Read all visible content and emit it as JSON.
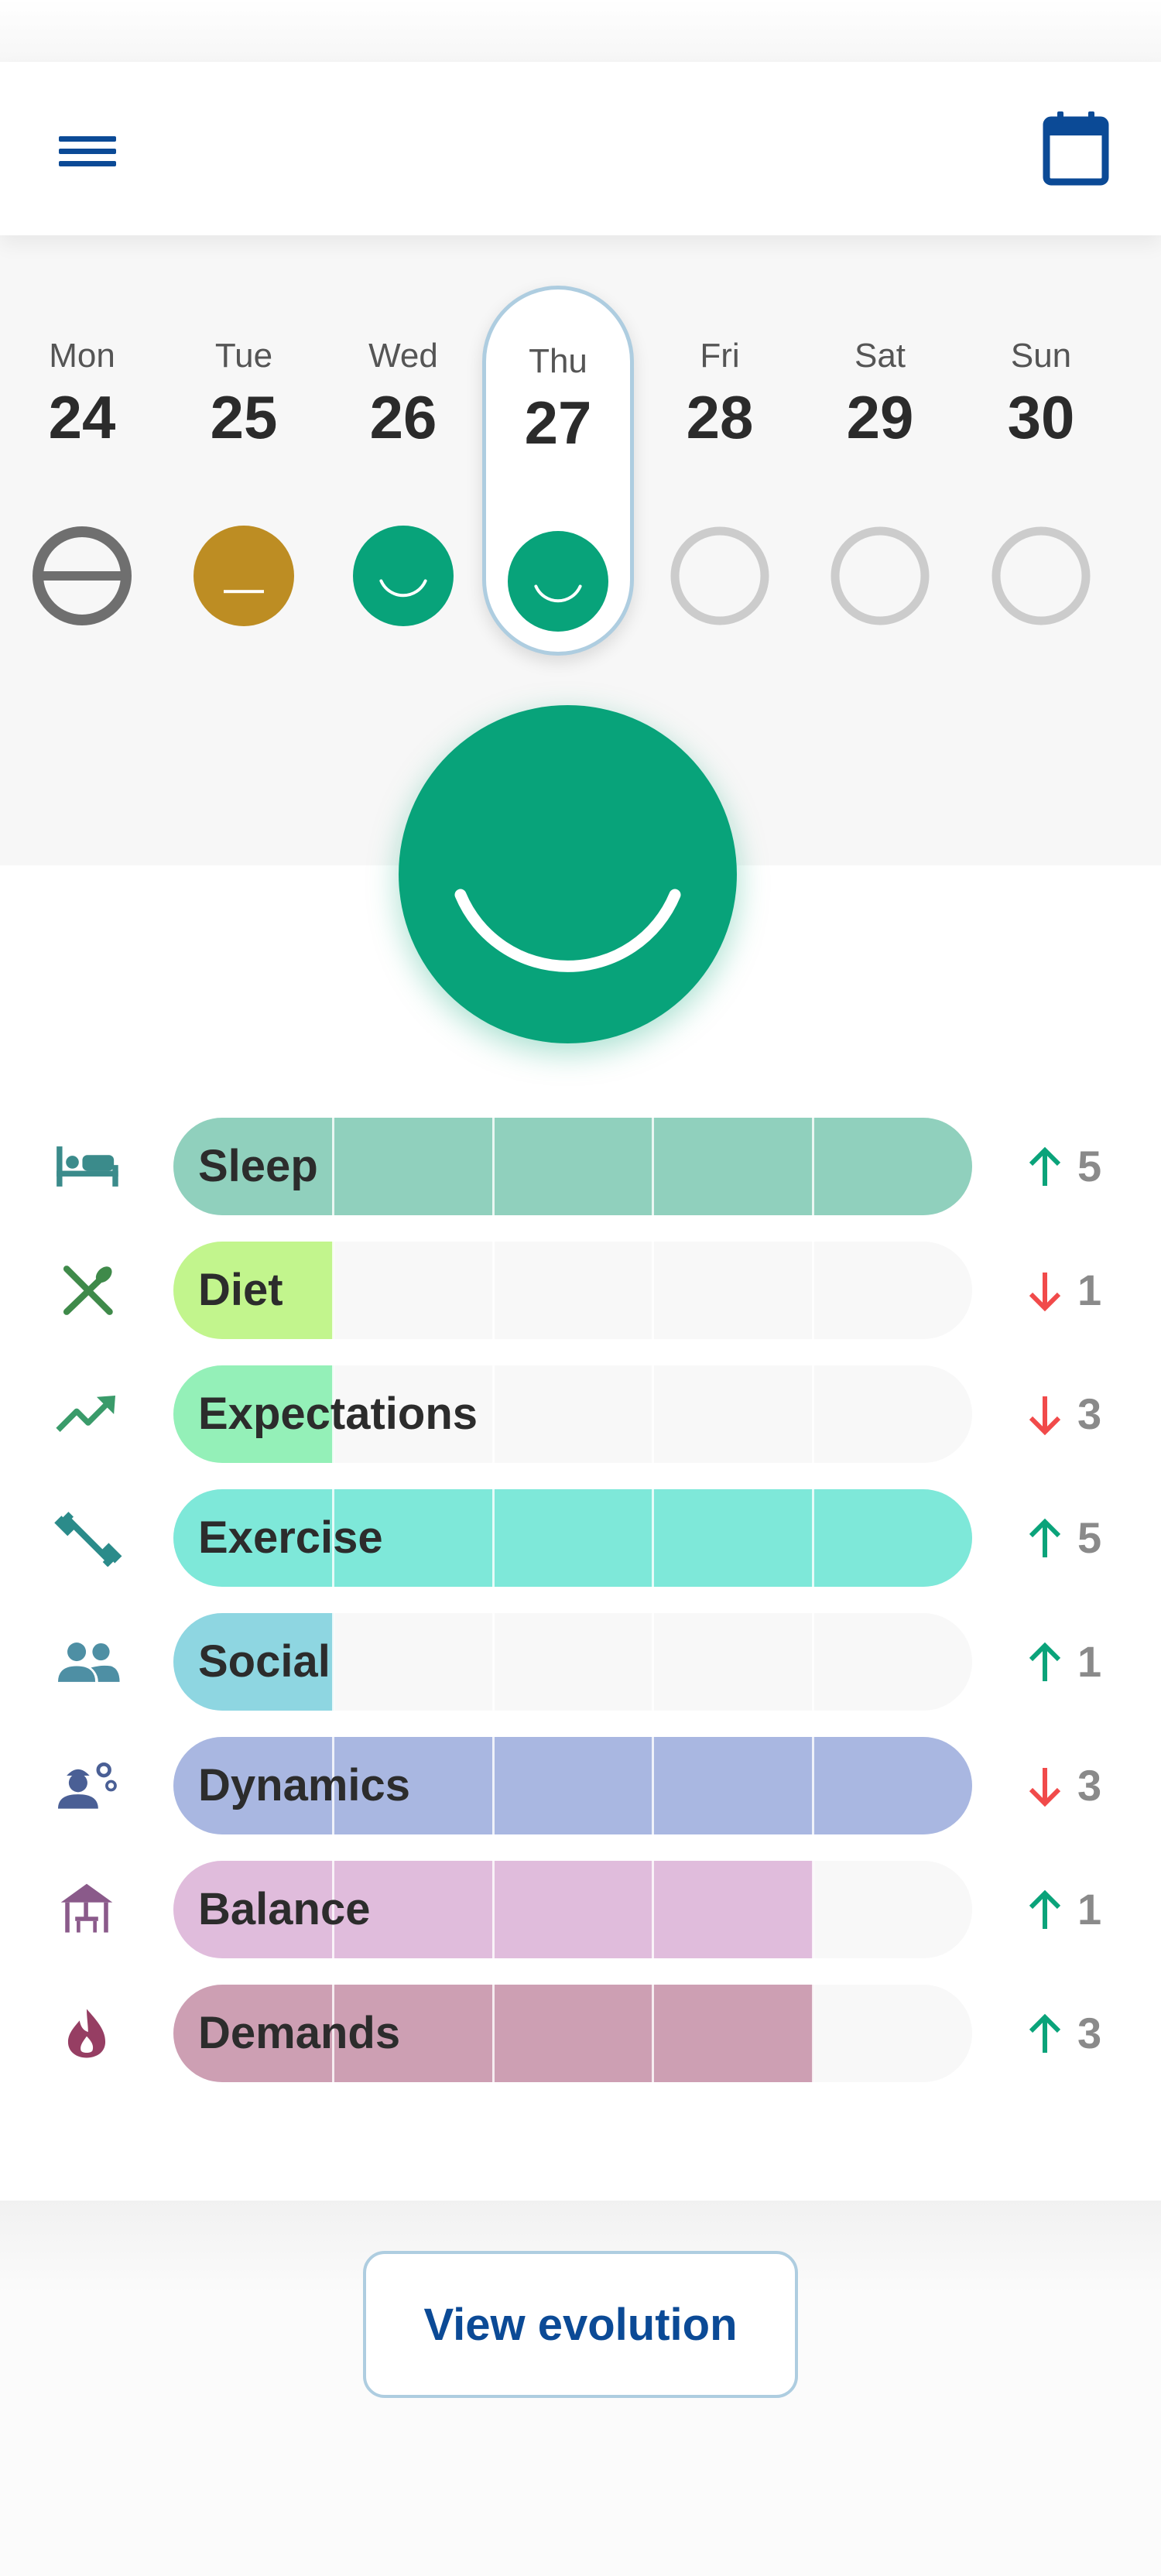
{
  "header": {
    "menu_icon": "hamburger-menu-icon",
    "calendar_icon": "calendar-icon",
    "accent_color": "#0b4a96"
  },
  "week": {
    "days": [
      {
        "name": "Mon",
        "date": "24",
        "mood": "no-entry",
        "selected": false
      },
      {
        "name": "Tue",
        "date": "25",
        "mood": "neutral",
        "selected": false
      },
      {
        "name": "Wed",
        "date": "26",
        "mood": "happy",
        "selected": false
      },
      {
        "name": "Thu",
        "date": "27",
        "mood": "happy",
        "selected": true
      },
      {
        "name": "Fri",
        "date": "28",
        "mood": "empty",
        "selected": false
      },
      {
        "name": "Sat",
        "date": "29",
        "mood": "empty",
        "selected": false
      },
      {
        "name": "Sun",
        "date": "30",
        "mood": "empty",
        "selected": false
      }
    ],
    "mood_colors": {
      "happy": "#08a37a",
      "neutral": "#bd8d23",
      "no-entry": "#6f6f6f",
      "empty": "#cccccc"
    }
  },
  "today_mood": {
    "mood": "happy",
    "color": "#08a37a"
  },
  "categories": [
    {
      "label": "Sleep",
      "icon": "bed-icon",
      "level": 5,
      "max": 5,
      "color": "#90d0bd",
      "trend": "up",
      "score": "5"
    },
    {
      "label": "Diet",
      "icon": "fork-spoon-icon",
      "level": 1,
      "max": 5,
      "color": "#c2f58d",
      "trend": "down",
      "score": "1"
    },
    {
      "label": "Expectations",
      "icon": "trending-up-icon",
      "level": 1,
      "max": 5,
      "color": "#94f0b8",
      "trend": "down",
      "score": "3"
    },
    {
      "label": "Exercise",
      "icon": "dumbbell-icon",
      "level": 5,
      "max": 5,
      "color": "#7ee8d9",
      "trend": "up",
      "score": "5"
    },
    {
      "label": "Social",
      "icon": "people-icon",
      "level": 1,
      "max": 5,
      "color": "#8ed6e1",
      "trend": "up",
      "score": "1"
    },
    {
      "label": "Dynamics",
      "icon": "worker-gears-icon",
      "level": 5,
      "max": 5,
      "color": "#a9b7e1",
      "trend": "down",
      "score": "3"
    },
    {
      "label": "Balance",
      "icon": "gazebo-icon",
      "level": 4,
      "max": 5,
      "color": "#e0bcdc",
      "trend": "up",
      "score": "1"
    },
    {
      "label": "Demands",
      "icon": "flame-icon",
      "level": 4,
      "max": 5,
      "color": "#cd9fb3",
      "trend": "up",
      "score": "3"
    }
  ],
  "trend_colors": {
    "up": "#0aa37a",
    "down": "#f14a4a"
  },
  "actions": {
    "view_evolution": "View evolution"
  }
}
